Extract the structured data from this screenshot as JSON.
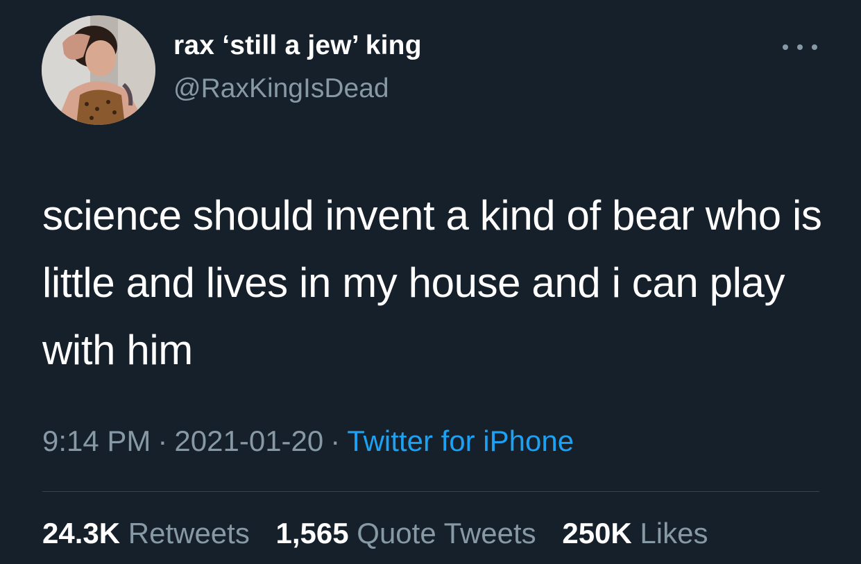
{
  "author": {
    "display_name": "rax ‘still a jew’ king",
    "handle": "@RaxKingIsDead",
    "avatar_icon": "profile-photo"
  },
  "menu": {
    "icon": "more-horizontal-icon"
  },
  "tweet": {
    "text": "science should invent a kind of bear who is little and lives in my house and i can play with him"
  },
  "meta": {
    "time": "9:14 PM",
    "separator": "·",
    "date": "2021-01-20",
    "source": "Twitter for iPhone"
  },
  "stats": {
    "retweets": {
      "count": "24.3K",
      "label": "Retweets"
    },
    "quotes": {
      "count": "1,565",
      "label": "Quote Tweets"
    },
    "likes": {
      "count": "250K",
      "label": "Likes"
    }
  },
  "colors": {
    "background": "#15202b",
    "primary_text": "#ffffff",
    "secondary_text": "#8899a6",
    "link": "#1da1f2",
    "divider": "#38444d"
  }
}
